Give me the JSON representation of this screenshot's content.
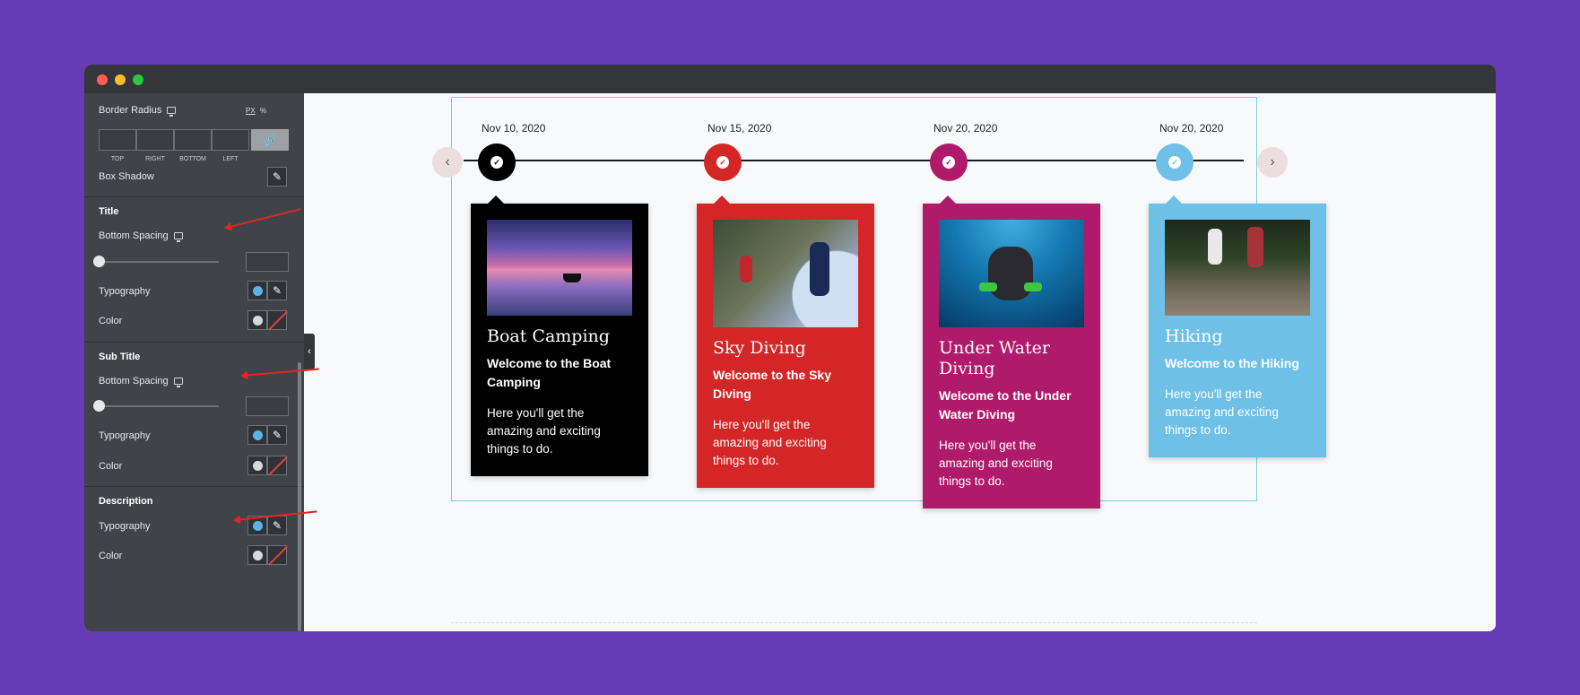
{
  "sidebar": {
    "border_radius": {
      "label": "Border Radius",
      "unit_px": "PX",
      "unit_percent": "%",
      "fields": [
        "TOP",
        "RIGHT",
        "BOTTOM",
        "LEFT"
      ]
    },
    "box_shadow_label": "Box Shadow",
    "title_section": {
      "heading": "Title",
      "bottom_spacing": "Bottom Spacing",
      "typography": "Typography",
      "color": "Color"
    },
    "subtitle_section": {
      "heading": "Sub Title",
      "bottom_spacing": "Bottom Spacing",
      "typography": "Typography",
      "color": "Color"
    },
    "description_section": {
      "heading": "Description",
      "typography": "Typography",
      "color": "Color"
    }
  },
  "timeline": {
    "prev_icon": "chevron-left-icon",
    "next_icon": "chevron-right-icon",
    "items": [
      {
        "date": "Nov 10, 2020",
        "color": "#000000",
        "title": "Boat Camping",
        "subtitle": "Welcome to the Boat Camping",
        "description": "Here you'll get the amazing and exciting things to do."
      },
      {
        "date": "Nov 15, 2020",
        "color": "#d42626",
        "title": "Sky Diving",
        "subtitle": "Welcome to the Sky Diving",
        "description": "Here you'll get the amazing and exciting things to do."
      },
      {
        "date": "Nov 20, 2020",
        "color": "#b01a6a",
        "title": "Under Water Diving",
        "subtitle": "Welcome to the Under Water Diving",
        "description": "Here you'll get the amazing and exciting things to do."
      },
      {
        "date": "Nov 20, 2020",
        "color": "#6ec0e6",
        "title": "Hiking",
        "subtitle": "Welcome to the Hiking",
        "description": "Here you'll get the amazing and exciting things to do."
      }
    ]
  }
}
